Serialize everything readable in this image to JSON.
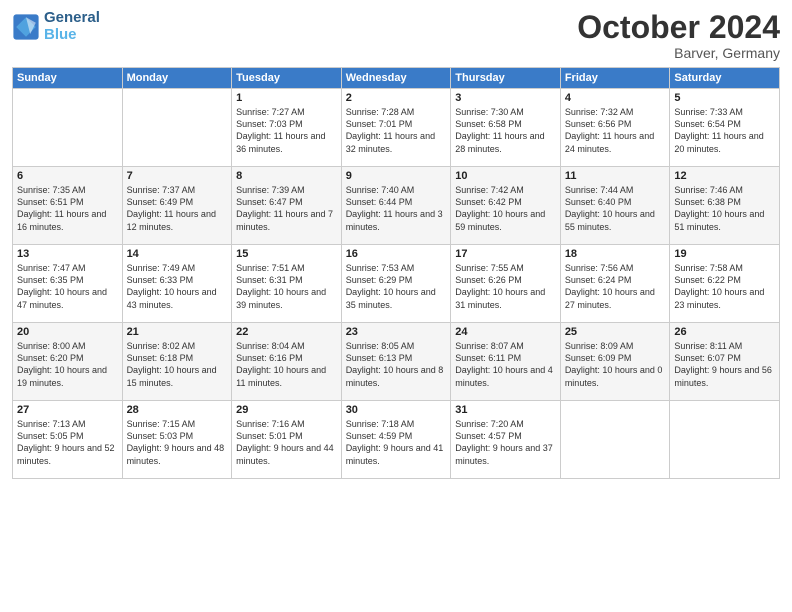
{
  "logo": {
    "line1": "General",
    "line2": "Blue"
  },
  "title": "October 2024",
  "location": "Barver, Germany",
  "days_header": [
    "Sunday",
    "Monday",
    "Tuesday",
    "Wednesday",
    "Thursday",
    "Friday",
    "Saturday"
  ],
  "weeks": [
    [
      {
        "day": "",
        "info": ""
      },
      {
        "day": "",
        "info": ""
      },
      {
        "day": "1",
        "info": "Sunrise: 7:27 AM\nSunset: 7:03 PM\nDaylight: 11 hours\nand 36 minutes."
      },
      {
        "day": "2",
        "info": "Sunrise: 7:28 AM\nSunset: 7:01 PM\nDaylight: 11 hours\nand 32 minutes."
      },
      {
        "day": "3",
        "info": "Sunrise: 7:30 AM\nSunset: 6:58 PM\nDaylight: 11 hours\nand 28 minutes."
      },
      {
        "day": "4",
        "info": "Sunrise: 7:32 AM\nSunset: 6:56 PM\nDaylight: 11 hours\nand 24 minutes."
      },
      {
        "day": "5",
        "info": "Sunrise: 7:33 AM\nSunset: 6:54 PM\nDaylight: 11 hours\nand 20 minutes."
      }
    ],
    [
      {
        "day": "6",
        "info": "Sunrise: 7:35 AM\nSunset: 6:51 PM\nDaylight: 11 hours\nand 16 minutes."
      },
      {
        "day": "7",
        "info": "Sunrise: 7:37 AM\nSunset: 6:49 PM\nDaylight: 11 hours\nand 12 minutes."
      },
      {
        "day": "8",
        "info": "Sunrise: 7:39 AM\nSunset: 6:47 PM\nDaylight: 11 hours\nand 7 minutes."
      },
      {
        "day": "9",
        "info": "Sunrise: 7:40 AM\nSunset: 6:44 PM\nDaylight: 11 hours\nand 3 minutes."
      },
      {
        "day": "10",
        "info": "Sunrise: 7:42 AM\nSunset: 6:42 PM\nDaylight: 10 hours\nand 59 minutes."
      },
      {
        "day": "11",
        "info": "Sunrise: 7:44 AM\nSunset: 6:40 PM\nDaylight: 10 hours\nand 55 minutes."
      },
      {
        "day": "12",
        "info": "Sunrise: 7:46 AM\nSunset: 6:38 PM\nDaylight: 10 hours\nand 51 minutes."
      }
    ],
    [
      {
        "day": "13",
        "info": "Sunrise: 7:47 AM\nSunset: 6:35 PM\nDaylight: 10 hours\nand 47 minutes."
      },
      {
        "day": "14",
        "info": "Sunrise: 7:49 AM\nSunset: 6:33 PM\nDaylight: 10 hours\nand 43 minutes."
      },
      {
        "day": "15",
        "info": "Sunrise: 7:51 AM\nSunset: 6:31 PM\nDaylight: 10 hours\nand 39 minutes."
      },
      {
        "day": "16",
        "info": "Sunrise: 7:53 AM\nSunset: 6:29 PM\nDaylight: 10 hours\nand 35 minutes."
      },
      {
        "day": "17",
        "info": "Sunrise: 7:55 AM\nSunset: 6:26 PM\nDaylight: 10 hours\nand 31 minutes."
      },
      {
        "day": "18",
        "info": "Sunrise: 7:56 AM\nSunset: 6:24 PM\nDaylight: 10 hours\nand 27 minutes."
      },
      {
        "day": "19",
        "info": "Sunrise: 7:58 AM\nSunset: 6:22 PM\nDaylight: 10 hours\nand 23 minutes."
      }
    ],
    [
      {
        "day": "20",
        "info": "Sunrise: 8:00 AM\nSunset: 6:20 PM\nDaylight: 10 hours\nand 19 minutes."
      },
      {
        "day": "21",
        "info": "Sunrise: 8:02 AM\nSunset: 6:18 PM\nDaylight: 10 hours\nand 15 minutes."
      },
      {
        "day": "22",
        "info": "Sunrise: 8:04 AM\nSunset: 6:16 PM\nDaylight: 10 hours\nand 11 minutes."
      },
      {
        "day": "23",
        "info": "Sunrise: 8:05 AM\nSunset: 6:13 PM\nDaylight: 10 hours\nand 8 minutes."
      },
      {
        "day": "24",
        "info": "Sunrise: 8:07 AM\nSunset: 6:11 PM\nDaylight: 10 hours\nand 4 minutes."
      },
      {
        "day": "25",
        "info": "Sunrise: 8:09 AM\nSunset: 6:09 PM\nDaylight: 10 hours\nand 0 minutes."
      },
      {
        "day": "26",
        "info": "Sunrise: 8:11 AM\nSunset: 6:07 PM\nDaylight: 9 hours\nand 56 minutes."
      }
    ],
    [
      {
        "day": "27",
        "info": "Sunrise: 7:13 AM\nSunset: 5:05 PM\nDaylight: 9 hours\nand 52 minutes."
      },
      {
        "day": "28",
        "info": "Sunrise: 7:15 AM\nSunset: 5:03 PM\nDaylight: 9 hours\nand 48 minutes."
      },
      {
        "day": "29",
        "info": "Sunrise: 7:16 AM\nSunset: 5:01 PM\nDaylight: 9 hours\nand 44 minutes."
      },
      {
        "day": "30",
        "info": "Sunrise: 7:18 AM\nSunset: 4:59 PM\nDaylight: 9 hours\nand 41 minutes."
      },
      {
        "day": "31",
        "info": "Sunrise: 7:20 AM\nSunset: 4:57 PM\nDaylight: 9 hours\nand 37 minutes."
      },
      {
        "day": "",
        "info": ""
      },
      {
        "day": "",
        "info": ""
      }
    ]
  ]
}
